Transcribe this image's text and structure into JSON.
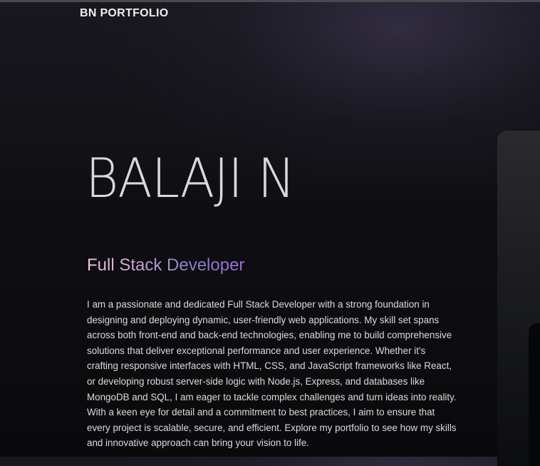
{
  "header": {
    "brand": "BN PORTFOLIO"
  },
  "hero": {
    "name": "BALAJI N",
    "title": "Full Stack Developer",
    "description": "I am a passionate and dedicated Full Stack Developer with a strong foundation in designing and deploying dynamic, user-friendly web applications. My skill set spans across both front-end and back-end technologies, enabling me to build comprehensive solutions that deliver exceptional performance and user experience. Whether it's crafting responsive interfaces with HTML, CSS, and JavaScript frameworks like React, or developing robust server-side logic with Node.js, Express, and databases like MongoDB and SQL, I am eager to tackle complex challenges and turn ideas into reality. With a keen eye for detail and a commitment to best practices, I aim to ensure that every project is scalable, secure, and efficient. Explore my portfolio to see how my skills and innovative approach can bring your vision to life."
  },
  "colors": {
    "background": "#0f0f13",
    "title_gradient_start": "#f2c8d6",
    "title_gradient_end": "#a06ad8"
  }
}
